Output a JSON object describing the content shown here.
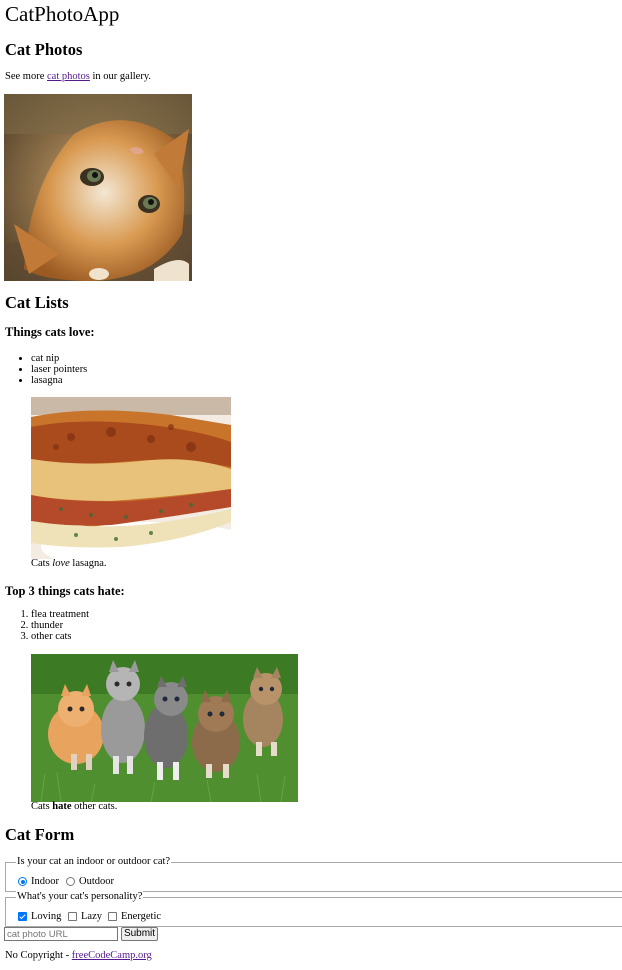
{
  "app": {
    "title": "CatPhotoApp"
  },
  "photos_section": {
    "heading": "Cat Photos",
    "intro_before": "See more ",
    "intro_link": "cat photos",
    "intro_after": " in our gallery."
  },
  "lists_section": {
    "heading": "Cat Lists",
    "love_heading": "Things cats love:",
    "love_items": [
      "cat nip",
      "laser pointers",
      "lasagna"
    ],
    "love_caption_before": "Cats ",
    "love_caption_em": "love",
    "love_caption_after": " lasagna.",
    "hate_heading": "Top 3 things cats hate:",
    "hate_items": [
      "flea treatment",
      "thunder",
      "other cats"
    ],
    "hate_caption_before": "Cats ",
    "hate_caption_strong": "hate",
    "hate_caption_after": " other cats."
  },
  "form_section": {
    "heading": "Cat Form",
    "location_legend": "Is your cat an indoor or outdoor cat?",
    "indoor_label": "Indoor",
    "outdoor_label": "Outdoor",
    "indoor_selected": true,
    "personality_legend": "What's your cat's personality?",
    "loving_label": "Loving",
    "lazy_label": "Lazy",
    "energetic_label": "Energetic",
    "loving_checked": true,
    "url_placeholder": "cat photo URL",
    "url_value": "",
    "submit_label": "Submit"
  },
  "footer": {
    "text": "No Copyright - ",
    "link": "freeCodeCamp.org"
  },
  "colors": {
    "link": "#551a8b",
    "control_accent": "#0075ff",
    "fieldset_border": "#a9a9a9"
  }
}
